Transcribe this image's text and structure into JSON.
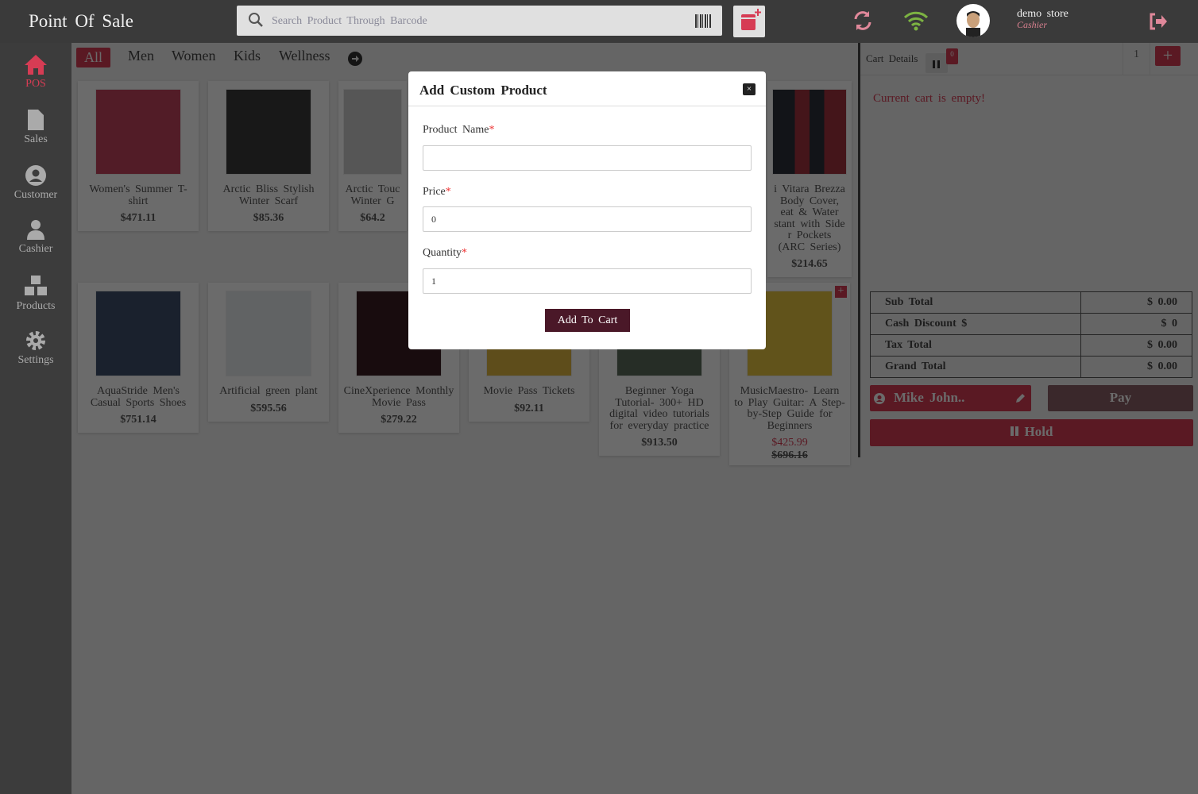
{
  "header": {
    "title": "Point Of Sale",
    "search_placeholder": "Search Product Through Barcode",
    "user_name": "demo store",
    "user_role": "Cashier"
  },
  "sidebar": {
    "items": [
      {
        "label": "POS",
        "icon": "home-icon",
        "active": true
      },
      {
        "label": "Sales",
        "icon": "file-icon"
      },
      {
        "label": "Customer",
        "icon": "user-circle-icon"
      },
      {
        "label": "Cashier",
        "icon": "user-icon"
      },
      {
        "label": "Products",
        "icon": "cubes-icon"
      },
      {
        "label": "Settings",
        "icon": "gear-icon"
      }
    ]
  },
  "categories": [
    "All",
    "Men",
    "Women",
    "Kids",
    "Wellness"
  ],
  "products": [
    {
      "name": "Women's Summer T-shirt",
      "price": "$471.11"
    },
    {
      "name": "Arctic Bliss Stylish Winter Scarf",
      "price": "$85.36"
    },
    {
      "name": "Arctic Touc Winter G",
      "price": "$64.2"
    },
    {
      "name": "i Vitara Brezza Body Cover, eat & Water stant with Side r Pockets (ARC Series)",
      "price": "$214.65"
    },
    {
      "name": "AquaStride Men's Casual Sports Shoes",
      "price": "$751.14"
    },
    {
      "name": "Artificial green plant",
      "price": "$595.56"
    },
    {
      "name": "CineXperience Monthly Movie Pass",
      "price": "$279.22"
    },
    {
      "name": "Movie Pass Tickets",
      "price": "$92.11"
    },
    {
      "name": "Beginner Yoga Tutorial- 300+ HD digital video tutorials for everyday practice",
      "price": "$913.50"
    },
    {
      "name": "MusicMaestro- Learn to Play Guitar: A Step-by-Step Guide for Beginners",
      "price": "$425.99",
      "old_price": "$696.16"
    }
  ],
  "cart": {
    "title": "Cart Details",
    "held_count": "0",
    "tab": "1",
    "empty_message": "Current cart is empty!",
    "totals": [
      {
        "label": "Sub Total",
        "value": "$ 0.00"
      },
      {
        "label": "Cash Discount $",
        "value": "$ 0"
      },
      {
        "label": "Tax Total",
        "value": "$ 0.00"
      },
      {
        "label": "Grand Total",
        "value": "$ 0.00"
      }
    ],
    "customer": "Mike John..",
    "pay_label": "Pay",
    "hold_label": "Hold"
  },
  "modal": {
    "title": "Add Custom Product",
    "name_label": "Product Name",
    "price_label": "Price",
    "price_value": "0",
    "qty_label": "Quantity",
    "qty_value": "1",
    "submit_label": "Add To Cart",
    "close_label": "×",
    "required_mark": "*"
  },
  "colors": {
    "accent": "#d63c54",
    "header": "#3a3a3a",
    "submit": "#4a1828"
  }
}
